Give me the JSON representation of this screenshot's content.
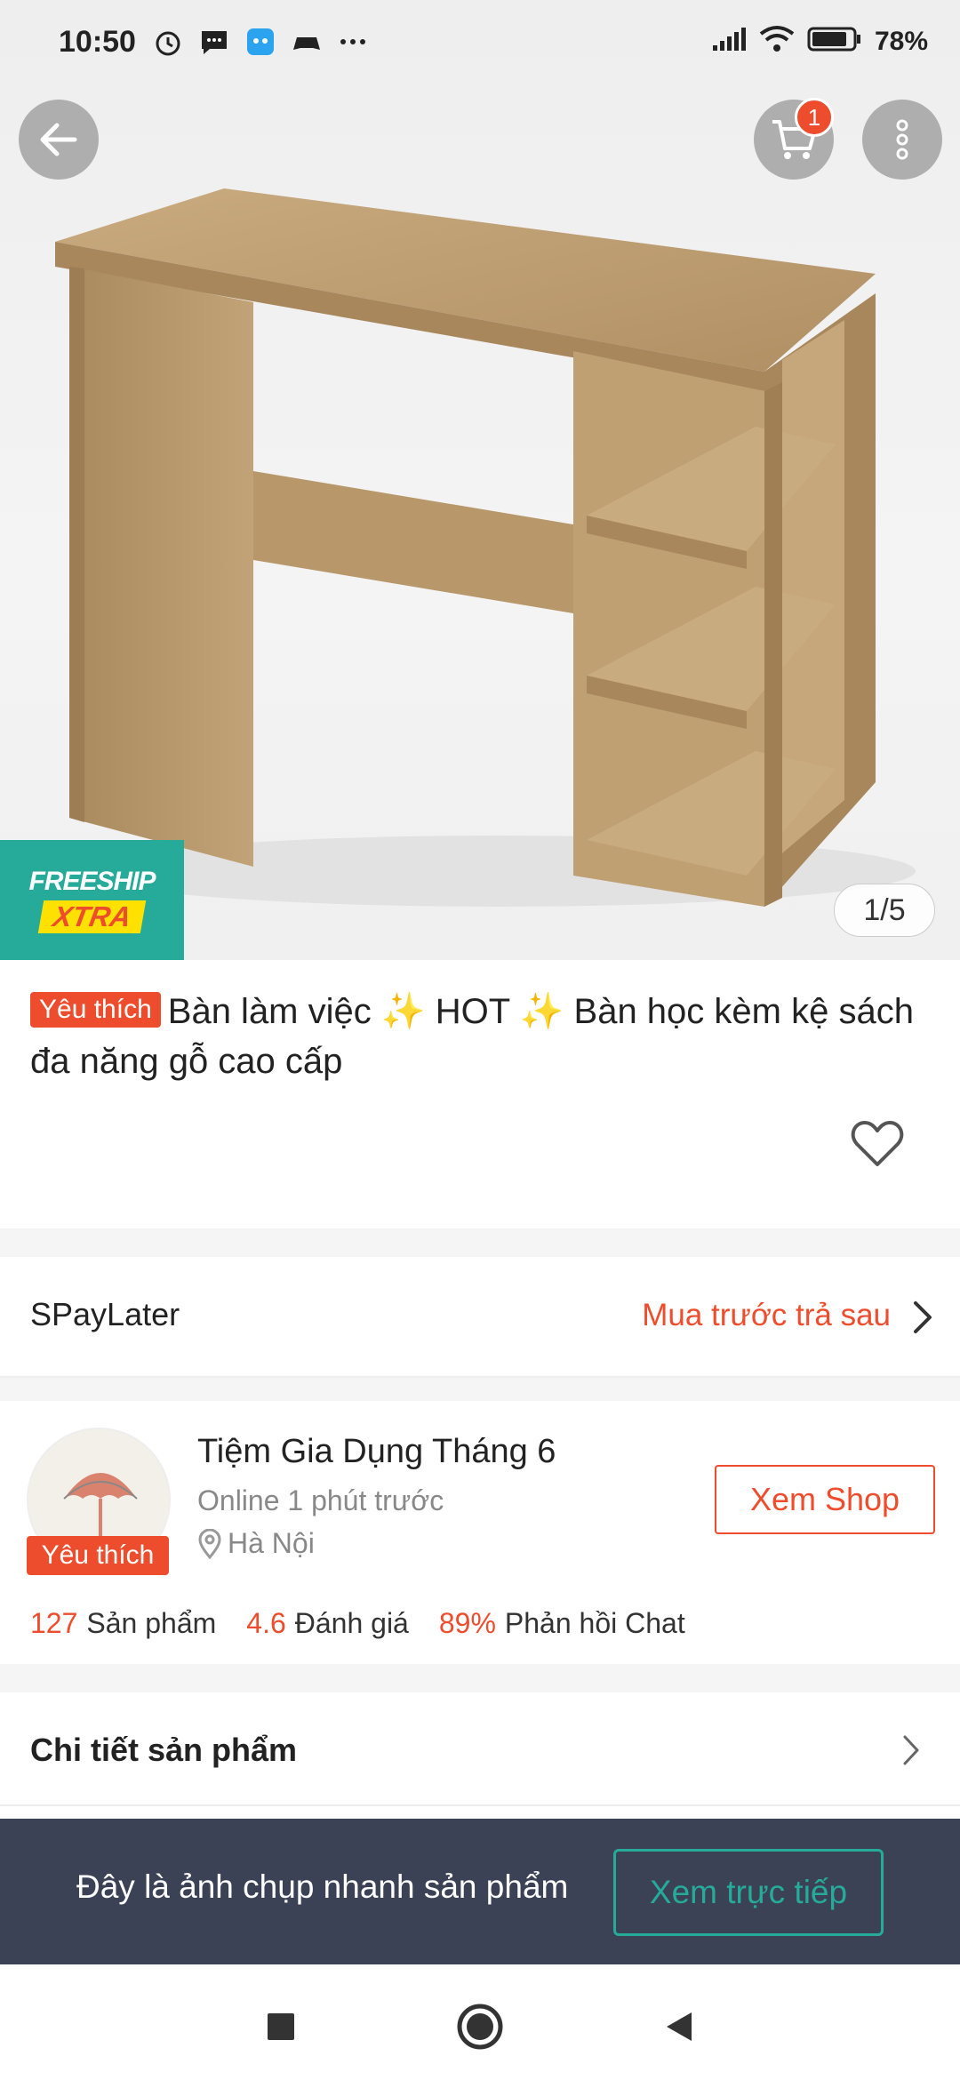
{
  "status_bar": {
    "time": "10:50",
    "battery": "78%",
    "icons_left": [
      "alarm-icon",
      "message-icon",
      "app-icon",
      "game-icon",
      "more-dots-icon"
    ],
    "icons_right": [
      "signal-icon",
      "wifi-icon",
      "battery-icon"
    ]
  },
  "hero": {
    "image_counter": "1/5",
    "freeship_line1": "FREESHIP",
    "freeship_line2": "XTRA",
    "cart_count": "1"
  },
  "product": {
    "badge": "Yêu thích",
    "title": "Bàn làm việc ✨ HOT ✨ Bàn học kèm kệ sách đa năng gỗ cao cấp"
  },
  "spaylater": {
    "label": "SPayLater",
    "value": "Mua trước trả sau"
  },
  "shop": {
    "name": "Tiệm Gia Dụng Tháng 6",
    "online": "Online 1 phút trước",
    "location": "Hà Nội",
    "badge": "Yêu thích",
    "button": "Xem Shop",
    "stats": [
      {
        "value": "127",
        "label": "Sản phẩm"
      },
      {
        "value": "4.6",
        "label": "Đánh giá"
      },
      {
        "value": "89%",
        "label": "Phản hồi Chat"
      }
    ]
  },
  "details": {
    "label": "Chi tiết sản phẩm"
  },
  "snapshot": {
    "text": "Đây là ảnh chụp nhanh sản phẩm",
    "button": "Xem trực tiếp"
  },
  "colors": {
    "accent": "#ee4d2d",
    "teal": "#26aa99",
    "snapshot_bg": "#3b4255"
  }
}
